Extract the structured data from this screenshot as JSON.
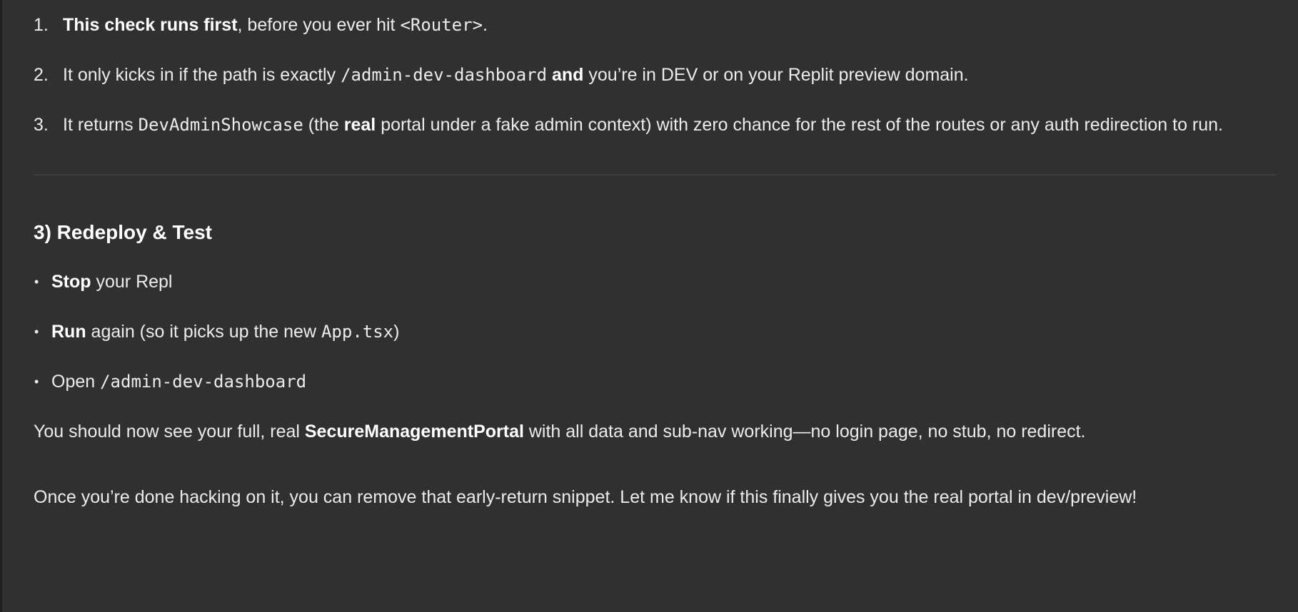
{
  "ordered_list": [
    {
      "number": "1.",
      "bold": "This check runs first",
      "text_after": ", before you ever hit ",
      "code": "<Router>",
      "text_end": "."
    },
    {
      "number": "2.",
      "text_before": "It only kicks in if the path is exactly ",
      "code": "/admin-dev-dashboard",
      "bold": "and",
      "text_after": " you’re in DEV or on your Replit preview domain."
    },
    {
      "number": "3.",
      "text_before": "It returns ",
      "code": "DevAdminShowcase",
      "text_mid": " (the ",
      "bold": "real",
      "text_after": " portal under a fake admin context) with zero chance for the rest of the routes or any auth redirection to run."
    }
  ],
  "section": {
    "heading": "3) Redeploy & Test",
    "bullets": [
      {
        "bullet": "•",
        "bold": "Stop",
        "text": " your Repl"
      },
      {
        "bullet": "•",
        "bold": "Run",
        "text": " again (so it picks up the new ",
        "code": "App.tsx",
        "text_end": ")"
      },
      {
        "bullet": "•",
        "text": "Open ",
        "code": "/admin-dev-dashboard"
      }
    ]
  },
  "paragraph1": {
    "text_before": "You should now see your full, real ",
    "bold": "SecureManagementPortal",
    "text_after": " with all data and sub-nav working—no login page, no stub, no redirect."
  },
  "paragraph2": {
    "text": "Once you’re done hacking on it, you can remove that early-return snippet. Let me know if this finally gives you the real portal in dev/preview!"
  },
  "colors": {
    "background": "#303030",
    "text": "#ececec",
    "divider": "#3e3e3e"
  }
}
